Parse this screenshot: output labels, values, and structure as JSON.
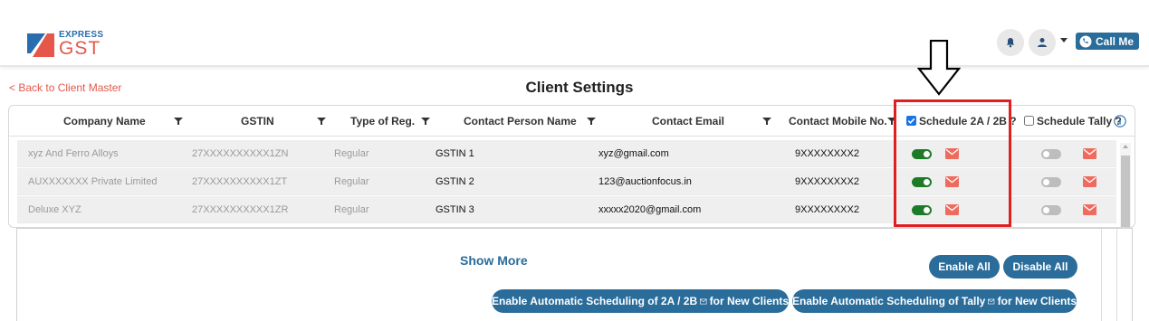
{
  "header": {
    "logo": {
      "top_text": "EXPRESS",
      "bottom_text": "GST"
    },
    "call_me_label": "Call Me",
    "icons": [
      "bell-icon",
      "user-icon",
      "phone-icon"
    ]
  },
  "page": {
    "back_link": "< Back to Client Master",
    "title": "Client Settings"
  },
  "table": {
    "columns": [
      "Company Name",
      "GSTIN",
      "Type of Reg.",
      "Contact Person Name",
      "Contact Email",
      "Contact Mobile No.",
      "Schedule 2A / 2B ?",
      "Schedule Tally ?"
    ],
    "schedule_2a_checked": true,
    "schedule_tally_checked": false,
    "rows": [
      {
        "company": "xyz And Ferro Alloys",
        "gstin": "27XXXXXXXXXX1ZN",
        "reg_type": "Regular",
        "contact_person": "GSTIN 1",
        "email": "xyz@gmail.com",
        "mobile": "9XXXXXXXX2",
        "schedule_2a": true,
        "schedule_tally": false
      },
      {
        "company": "AUXXXXXXX Private Limited",
        "gstin": "27XXXXXXXXXX1ZT",
        "reg_type": "Regular",
        "contact_person": "GSTIN 2",
        "email": "123@auctionfocus.in",
        "mobile": "9XXXXXXXX2",
        "schedule_2a": true,
        "schedule_tally": false
      },
      {
        "company": "Deluxe XYZ",
        "gstin": "27XXXXXXXXXX1ZR",
        "reg_type": "Regular",
        "contact_person": "GSTIN 3",
        "email": "xxxxx2020@gmail.com",
        "mobile": "9XXXXXXXX2",
        "schedule_2a": true,
        "schedule_tally": false
      }
    ]
  },
  "actions": {
    "show_more": "Show More",
    "enable_all": "Enable All",
    "disable_all": "Disable All",
    "auto_2a_prefix": "Enable Automatic Scheduling of 2A / 2B",
    "auto_2a_suffix": "for New Clients",
    "auto_tally_prefix": "Enable Automatic Scheduling of Tally",
    "auto_tally_suffix": "for New Clients"
  },
  "colors": {
    "accent": "#2a6c9a",
    "brand_red": "#e4574a",
    "toggle_on": "#1d7a27",
    "toggle_off": "#bdbdbd",
    "highlight": "#e02020"
  }
}
